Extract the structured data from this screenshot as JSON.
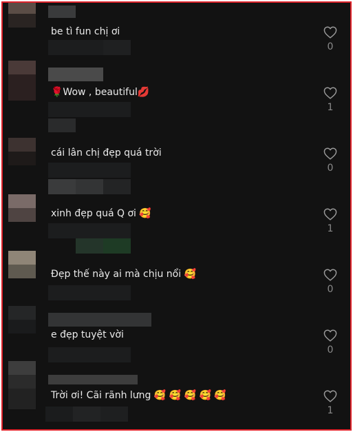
{
  "comments": [
    {
      "text": "be tì fun chị ơi",
      "likes": "0",
      "colors": [
        "#5b4d46",
        "#2a2422"
      ]
    },
    {
      "text": "🌹Wow , beautiful💋",
      "likes": "1",
      "colors": [
        "#4a3a38",
        "#2b2020"
      ]
    },
    {
      "text": "cái lân chị đẹp quá trời",
      "likes": "0",
      "colors": [
        "#3d3230",
        "#1e1a19"
      ]
    },
    {
      "text": "xinh đẹp quá Q ơi 🥰",
      "likes": "1",
      "colors": [
        "#7a6b68",
        "#4f4442"
      ]
    },
    {
      "text": "Đẹp thế này ai mà chịu nổi 🥰",
      "likes": "0",
      "colors": [
        "#8f8577",
        "#5f5a50"
      ]
    },
    {
      "text": "e đẹp tuyệt vời",
      "likes": "0",
      "colors": [
        "#252627",
        "#1a1b1c"
      ]
    },
    {
      "text": "Trời ơi! Cãi rãnh lưng 🥰 🥰 🥰 🥰 🥰",
      "likes": "1",
      "colors": [
        "#3d3d3d",
        "#2b2b2b"
      ]
    }
  ],
  "colors": {
    "background": "#121212",
    "border": "#e0232b",
    "text": "#eaeaea",
    "count": "#8a8a8a"
  },
  "icons": {
    "like": "heart-outline-icon"
  }
}
